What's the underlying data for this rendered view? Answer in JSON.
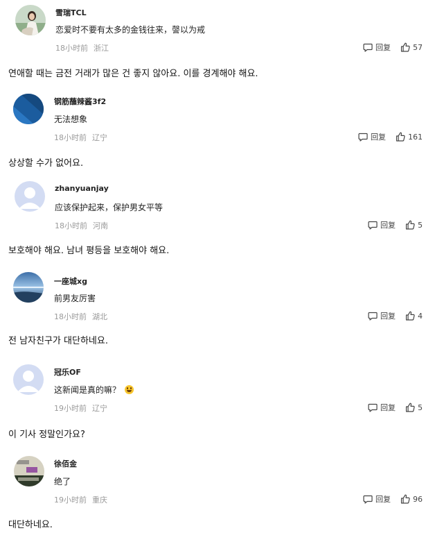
{
  "comments": [
    {
      "username": "雪瑞TCL",
      "text": "恋爱时不要有太多的金钱往来，謦以为戒",
      "time": "18小时前",
      "location": "浙江",
      "reply_label": "回复",
      "likes": "57",
      "translation": "연애할 때는 금전 거래가 많은 건 좋지 않아요. 이를 경계해야 해요."
    },
    {
      "username": "钢筋蘸辣酱3f2",
      "text": "无法想象",
      "time": "18小时前",
      "location": "辽宁",
      "reply_label": "回复",
      "likes": "161",
      "translation": "상상할 수가 없어요."
    },
    {
      "username": "zhanyuanjay",
      "text": "应该保护起来，保护男女平等",
      "time": "18小时前",
      "location": "河南",
      "reply_label": "回复",
      "likes": "5",
      "translation": "보호해야 해요. 남녀 평등을 보호해야 해요."
    },
    {
      "username": "一座城xg",
      "text": "前男友厉害",
      "time": "18小时前",
      "location": "湖北",
      "reply_label": "回复",
      "likes": "4",
      "translation": "전 남자친구가 대단하네요."
    },
    {
      "username": "冠乐OF",
      "text": "这新闻是真的嘛？",
      "time": "19小时前",
      "location": "辽宁",
      "reply_label": "回复",
      "likes": "5",
      "translation": "이 기사 정말인가요?"
    },
    {
      "username": "徐佰金",
      "text": "绝了",
      "time": "19小时前",
      "location": "重庆",
      "reply_label": "回复",
      "likes": "96",
      "translation": "대단하네요."
    }
  ],
  "icons": {
    "reply": "comment-bubble-icon",
    "like": "thumbs-up-icon",
    "emoji": "laughing-emoji-icon"
  },
  "colors": {
    "meta_text": "#9a9a9a",
    "body_text": "#222222",
    "default_avatar": "#d3dcf3"
  }
}
